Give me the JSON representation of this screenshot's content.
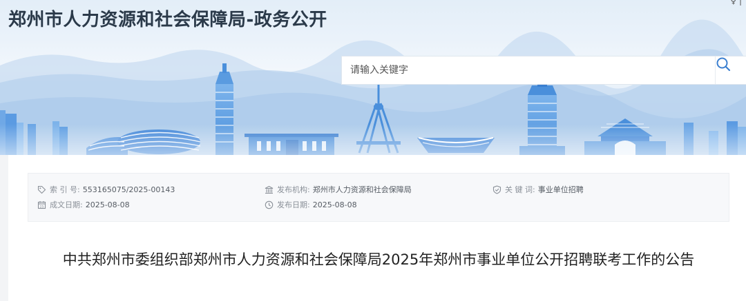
{
  "header": {
    "site_title": "郑州市人力资源和社会保障局-政务公开",
    "corner_mark": "♀ |"
  },
  "search": {
    "placeholder": "请输入关键字",
    "value": ""
  },
  "meta": {
    "index_label": "索 引 号:",
    "index_value": "553165075/2025-00143",
    "publisher_label": "发布机构:",
    "publisher_value": "郑州市人力资源和社会保障局",
    "keywords_label": "关 键 词:",
    "keywords_value": "事业单位招聘",
    "created_label": "成文日期:",
    "created_value": "2025-08-08",
    "published_label": "发布日期:",
    "published_value": "2025-08-08"
  },
  "article": {
    "title": "中共郑州市委组织部郑州市人力资源和社会保障局2025年郑州市事业单位公开招聘联考工作的公告"
  },
  "icons": {
    "index": "tag-icon",
    "publisher": "building-icon",
    "keywords": "shield-icon",
    "created": "calendar-icon",
    "published": "clock-icon",
    "search": "search-icon"
  },
  "colors": {
    "skyline": "#5a9be0",
    "title_text": "#2b3a4a",
    "search_icon": "#3b7fd0",
    "meta_bg": "#f7f8fa"
  }
}
